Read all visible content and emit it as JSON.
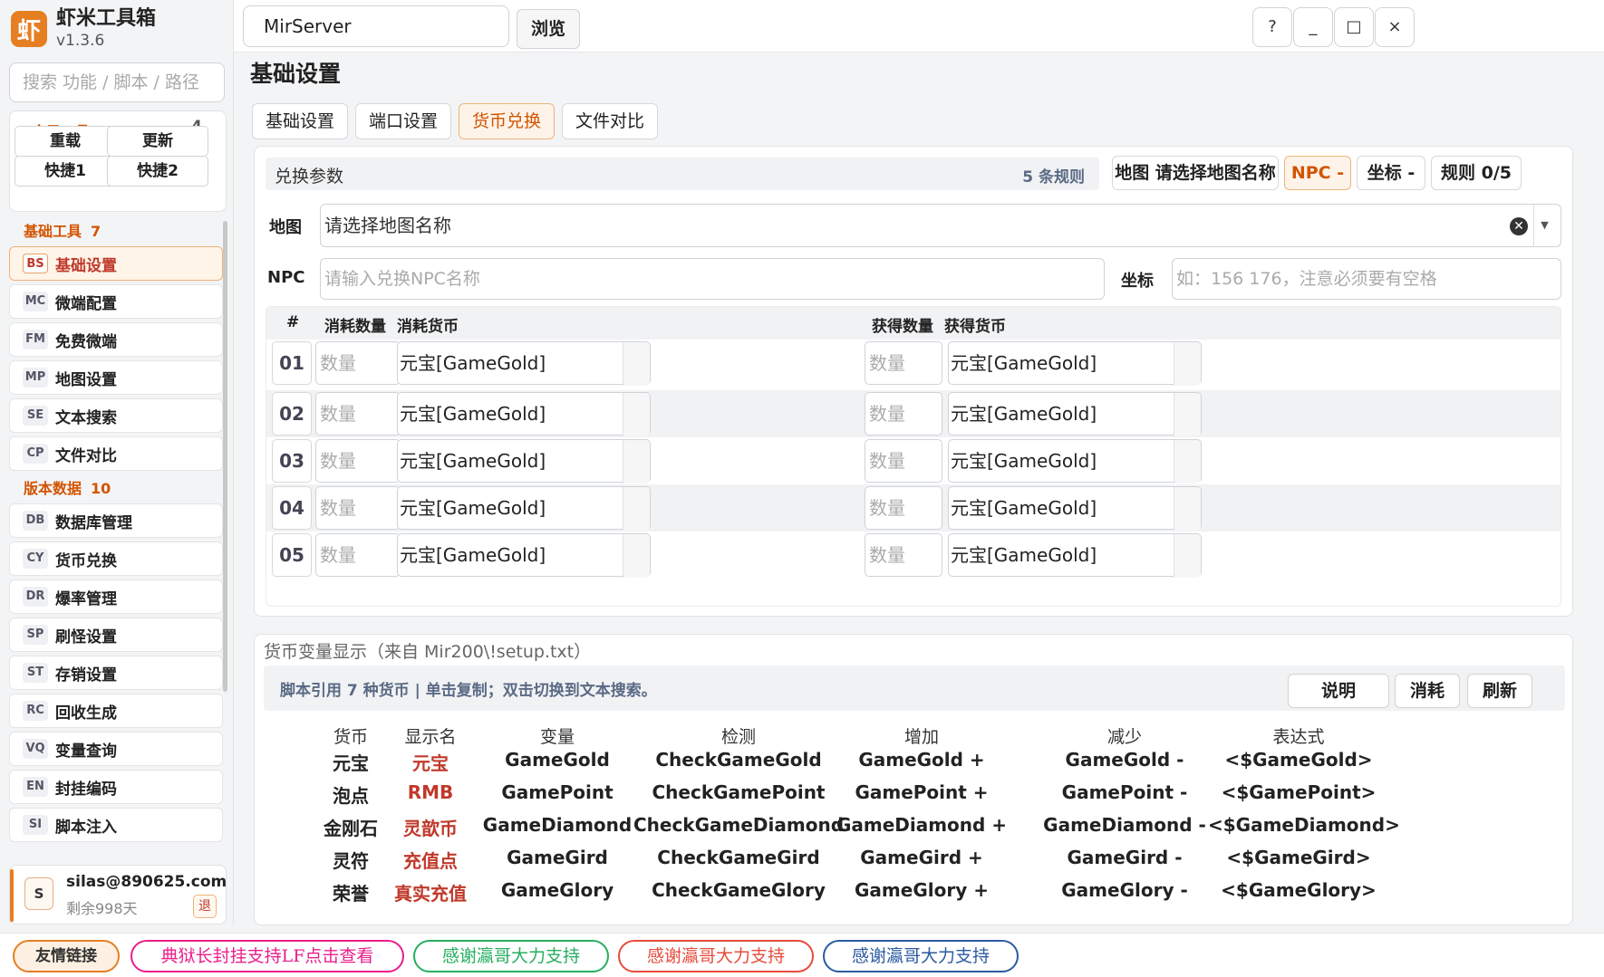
{
  "app": {
    "logo_char": "虾",
    "name": "虾米工具箱",
    "version": "v1.3.6"
  },
  "sidebar": {
    "search_placeholder": "搜索 功能 / 脚本 / 路径",
    "global": {
      "title": "全局工具",
      "count": "4",
      "buttons": [
        "重载",
        "更新",
        "快捷1",
        "快捷2"
      ]
    },
    "groups": [
      {
        "title": "基础工具",
        "count": "7",
        "items": [
          {
            "badge": "BS",
            "label": "基础设置",
            "active": true
          },
          {
            "badge": "MC",
            "label": "微端配置"
          },
          {
            "badge": "FM",
            "label": "免费微端"
          },
          {
            "badge": "MP",
            "label": "地图设置"
          },
          {
            "badge": "SE",
            "label": "文本搜索"
          },
          {
            "badge": "CP",
            "label": "文件对比"
          }
        ]
      },
      {
        "title": "版本数据",
        "count": "10",
        "items": [
          {
            "badge": "DB",
            "label": "数据库管理"
          },
          {
            "badge": "CY",
            "label": "货币兑换"
          },
          {
            "badge": "DR",
            "label": "爆率管理"
          },
          {
            "badge": "SP",
            "label": "刷怪设置"
          },
          {
            "badge": "ST",
            "label": "存销设置"
          },
          {
            "badge": "RC",
            "label": "回收生成"
          },
          {
            "badge": "VQ",
            "label": "变量查询"
          },
          {
            "badge": "EN",
            "label": "封挂编码"
          },
          {
            "badge": "SI",
            "label": "脚本注入"
          }
        ]
      }
    ],
    "user": {
      "avatar": "S",
      "email": "silas@890625.com",
      "days": "剩余998天",
      "logout": "退"
    }
  },
  "topbar": {
    "path": "MirServer",
    "browse": "浏览",
    "help": "?",
    "minimize": "_",
    "maximize": "□",
    "close": "×"
  },
  "main": {
    "title": "基础设置",
    "tabs": [
      {
        "label": "基础设置"
      },
      {
        "label": "端口设置"
      },
      {
        "label": "货币兑换",
        "active": true
      },
      {
        "label": "文件对比"
      }
    ],
    "exchange": {
      "head_title": "兑换参数",
      "rule_count": "5 条规则",
      "chip_map": "地图 请选择地图名称",
      "chip_npc": "NPC -",
      "chip_coord": "坐标 -",
      "chip_rules": "规则 0/5",
      "map_label": "地图",
      "map_value": "请选择地图名称",
      "npc_label": "NPC",
      "npc_placeholder": "请输入兑换NPC名称",
      "coord_label": "坐标",
      "coord_placeholder": "如：156 176，注意必须要有空格",
      "columns": {
        "num": "#",
        "cost_qty": "消耗数量",
        "cost_cur": "消耗货币",
        "gain_qty": "获得数量",
        "gain_cur": "获得货币"
      },
      "qty_placeholder": "数量",
      "rows": [
        {
          "num": "01",
          "cost": "元宝[GameGold]",
          "gain": "元宝[GameGold]"
        },
        {
          "num": "02",
          "cost": "元宝[GameGold]",
          "gain": "元宝[GameGold]"
        },
        {
          "num": "03",
          "cost": "元宝[GameGold]",
          "gain": "元宝[GameGold]"
        },
        {
          "num": "04",
          "cost": "元宝[GameGold]",
          "gain": "元宝[GameGold]"
        },
        {
          "num": "05",
          "cost": "元宝[GameGold]",
          "gain": "元宝[GameGold]"
        }
      ]
    },
    "currency": {
      "title": "货币变量显示（来自 Mir200\\!setup.txt）",
      "info": "脚本引用  7 种货币 | 单击复制；双击切换到文本搜索。",
      "buttons": [
        "说明",
        "消耗",
        "刷新"
      ],
      "headers": [
        "货币",
        "显示名",
        "变量",
        "检测",
        "增加",
        "减少",
        "表达式"
      ],
      "rows": [
        [
          "元宝",
          "元宝",
          "GameGold",
          "CheckGameGold",
          "GameGold +",
          "GameGold -",
          "<$GameGold>"
        ],
        [
          "泡点",
          "RMB",
          "GamePoint",
          "CheckGamePoint",
          "GamePoint +",
          "GamePoint -",
          "<$GamePoint>"
        ],
        [
          "金刚石",
          "灵歆币",
          "GameDiamond",
          "CheckGameDiamond",
          "GameDiamond +",
          "GameDiamond -",
          "<$GameDiamond>"
        ],
        [
          "灵符",
          "充值点",
          "GameGird",
          "CheckGameGird",
          "GameGird +",
          "GameGird -",
          "<$GameGird>"
        ],
        [
          "荣誉",
          "真实充值",
          "GameGlory",
          "CheckGameGlory",
          "GameGlory +",
          "GameGlory -",
          "<$GameGlory>"
        ]
      ]
    }
  },
  "footer": {
    "links": [
      {
        "label": "友情链接",
        "color": "#e67e22"
      },
      {
        "label": "典狱长封挂支持LF点击查看",
        "color": "#e91e8c"
      },
      {
        "label": "感谢瀛哥大力支持",
        "color": "#27ae60"
      },
      {
        "label": "感谢瀛哥大力支持",
        "color": "#e74c3c"
      },
      {
        "label": "感谢瀛哥大力支持",
        "color": "#2c5aa0"
      }
    ]
  }
}
